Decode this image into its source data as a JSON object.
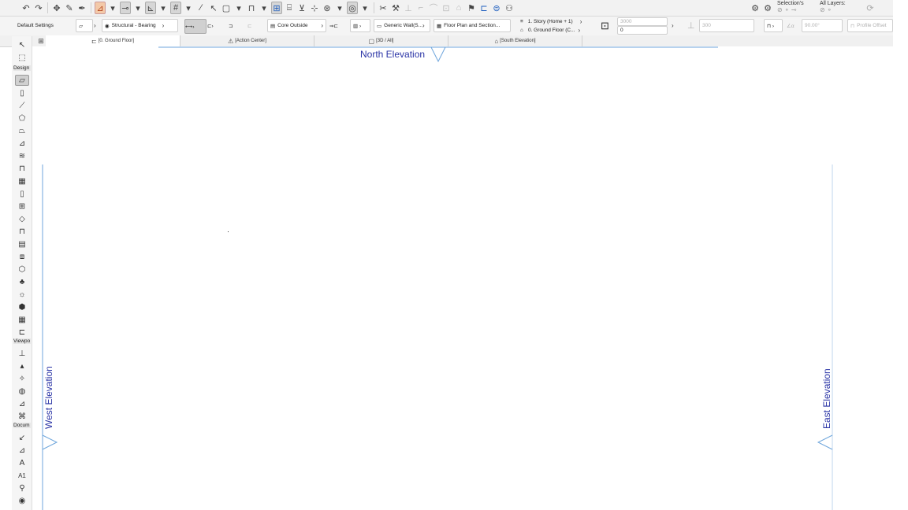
{
  "toolbar": {
    "undo_icon": "undo-icon",
    "redo_icon": "redo-icon",
    "selections_label": "Selection's",
    "layers_label": "All Layers:"
  },
  "info_box": {
    "default_settings": "Default Settings",
    "structure": "Structural - Bearing",
    "reference_line": "Core Outside",
    "composite": "Generic Wall(S...",
    "floor_plan": "Floor Plan and Section...",
    "top_story": "1. Story (Home + 1)",
    "home_story": "0. Ground Floor (C...",
    "height_value": "3000",
    "offset_value": "0",
    "thickness_value": "300",
    "angle_value": "90.00°",
    "profile_offset": "Profile Offset"
  },
  "tabs": [
    {
      "label": "[0. Ground Floor]"
    },
    {
      "label": "[Action Center]"
    },
    {
      "label": "[3D / All]"
    },
    {
      "label": "[South Elevation]"
    }
  ],
  "toolbox": {
    "design_label": "Design",
    "viewpoint_label": "Viewpo",
    "document_label": "Docum",
    "label_tool_text": "A1"
  },
  "canvas": {
    "north_elevation": "North Elevation",
    "west_elevation": "West Elevation",
    "east_elevation": "East Elevation"
  },
  "colors": {
    "elevation_marker": "#2a34a6",
    "marker_line": "#6fa6dc",
    "selected_tool": "#d0d0d0",
    "warning_tool": "#f3c9a8"
  }
}
